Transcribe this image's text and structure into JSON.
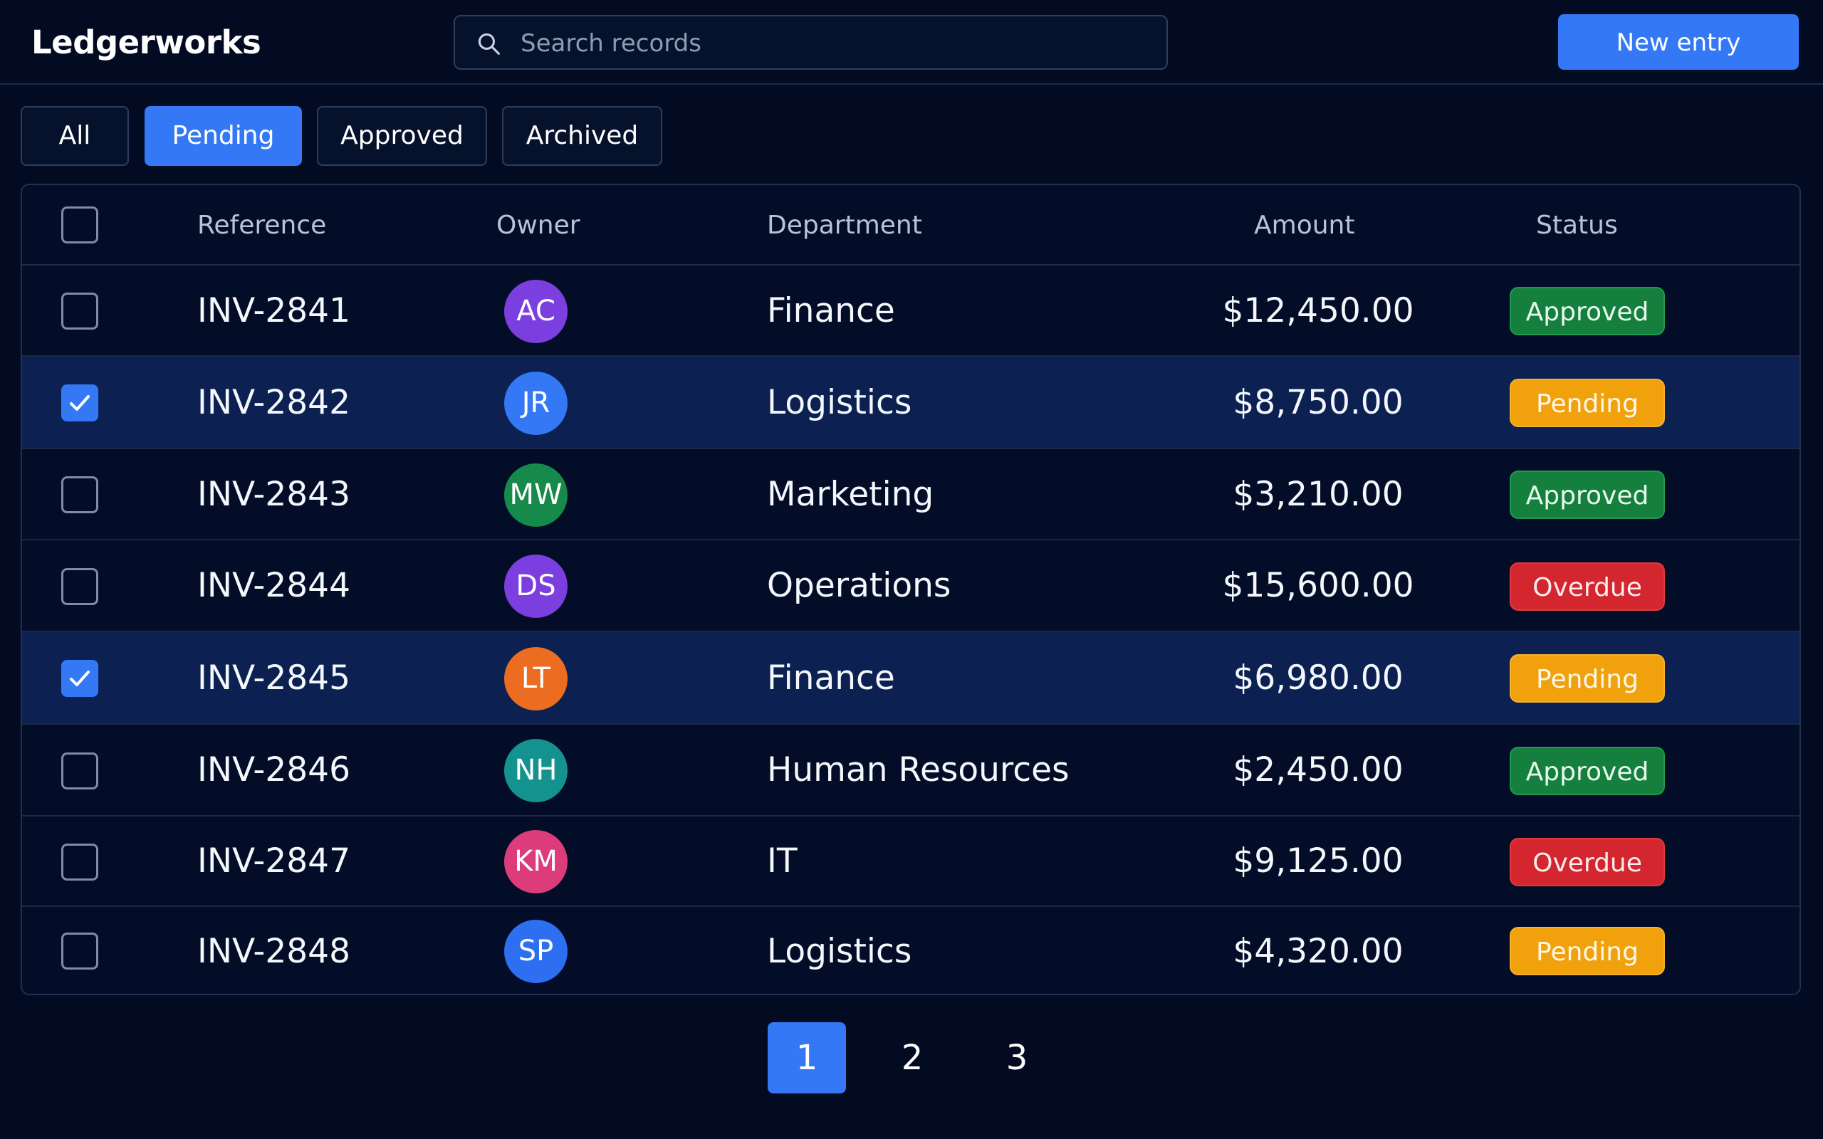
{
  "app": {
    "title": "Ledgerworks"
  },
  "search": {
    "placeholder": "Search records",
    "value": "",
    "icon": "search-icon"
  },
  "header": {
    "new_entry_label": "New entry"
  },
  "filters": [
    {
      "label": "All",
      "active": false
    },
    {
      "label": "Pending",
      "active": true
    },
    {
      "label": "Approved",
      "active": false
    },
    {
      "label": "Archived",
      "active": false
    }
  ],
  "table": {
    "columns": {
      "reference": "Reference",
      "owner": "Owner",
      "department": "Department",
      "amount": "Amount",
      "status": "Status"
    },
    "select_all_checked": false,
    "rows": [
      {
        "selected": false,
        "reference": "INV-2841",
        "owner_initials": "AC",
        "owner_color": "#7b3fe0",
        "department": "Finance",
        "amount": "$12,450.00",
        "status": "Approved"
      },
      {
        "selected": true,
        "reference": "INV-2842",
        "owner_initials": "JR",
        "owner_color": "#3478f6",
        "department": "Logistics",
        "amount": "$8,750.00",
        "status": "Pending"
      },
      {
        "selected": false,
        "reference": "INV-2843",
        "owner_initials": "MW",
        "owner_color": "#168a4a",
        "department": "Marketing",
        "amount": "$3,210.00",
        "status": "Approved"
      },
      {
        "selected": false,
        "reference": "INV-2844",
        "owner_initials": "DS",
        "owner_color": "#7b3fe0",
        "department": "Operations",
        "amount": "$15,600.00",
        "status": "Overdue"
      },
      {
        "selected": true,
        "reference": "INV-2845",
        "owner_initials": "LT",
        "owner_color": "#ec6d1f",
        "department": "Finance",
        "amount": "$6,980.00",
        "status": "Pending"
      },
      {
        "selected": false,
        "reference": "INV-2846",
        "owner_initials": "NH",
        "owner_color": "#14928f",
        "department": "Human Resources",
        "amount": "$2,450.00",
        "status": "Approved"
      },
      {
        "selected": false,
        "reference": "INV-2847",
        "owner_initials": "KM",
        "owner_color": "#dc3d7a",
        "department": "IT",
        "amount": "$9,125.00",
        "status": "Overdue"
      },
      {
        "selected": false,
        "reference": "INV-2848",
        "owner_initials": "SP",
        "owner_color": "#2d6ff0",
        "department": "Logistics",
        "amount": "$4,320.00",
        "status": "Pending"
      }
    ]
  },
  "status_colors": {
    "Approved": {
      "bg": "#15803d",
      "border": "#1f9a4e",
      "text": "#e8f8ee"
    },
    "Pending": {
      "bg": "#f0a10c",
      "border": "#f6b32a",
      "text": "#fff7e6"
    },
    "Overdue": {
      "bg": "#d3262f",
      "border": "#e03a42",
      "text": "#fdeced"
    }
  },
  "pagination": {
    "pages": [
      "1",
      "2",
      "3"
    ],
    "current": "1"
  },
  "theme": {
    "accent": "#3478f6",
    "background": "#020b22"
  }
}
